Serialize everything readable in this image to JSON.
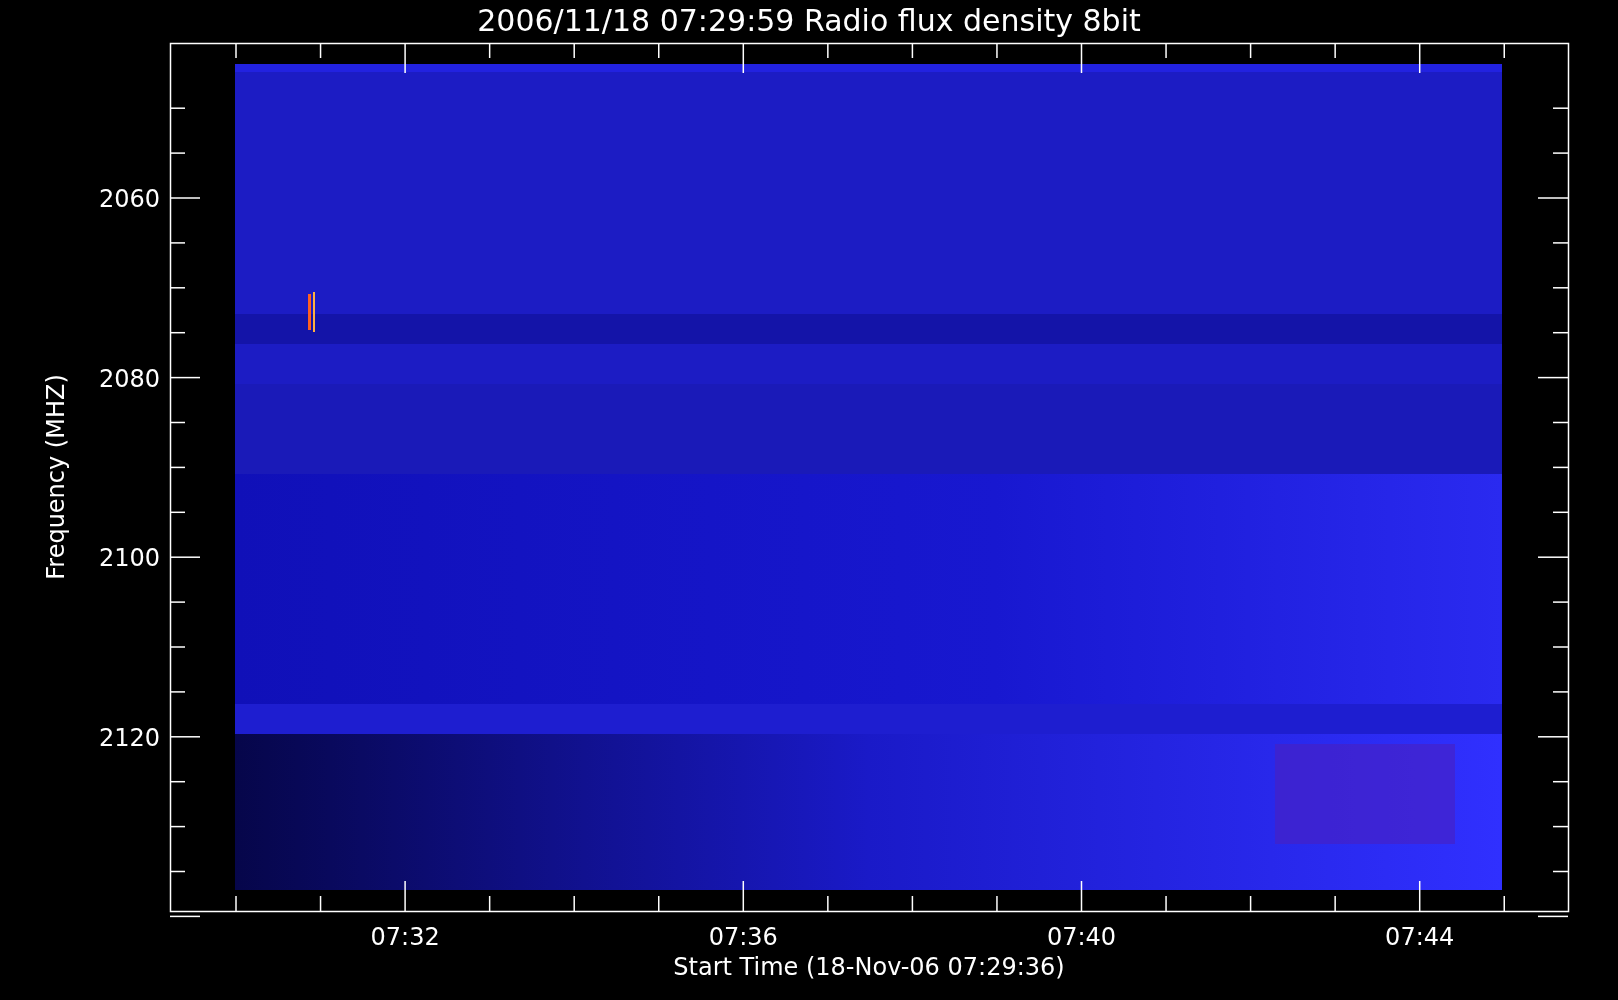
{
  "title": "2006/11/18 07:29:59 Radio flux density 8bit",
  "plot": {
    "ylabel": "Frequency (MHZ)",
    "xlabel": "Start Time (18-Nov-06 07:29:36)",
    "yticks": [
      "2060",
      "2080",
      "2100",
      "2120"
    ],
    "xticks": [
      "07:32",
      "07:36",
      "07:40",
      "07:44"
    ]
  }
}
